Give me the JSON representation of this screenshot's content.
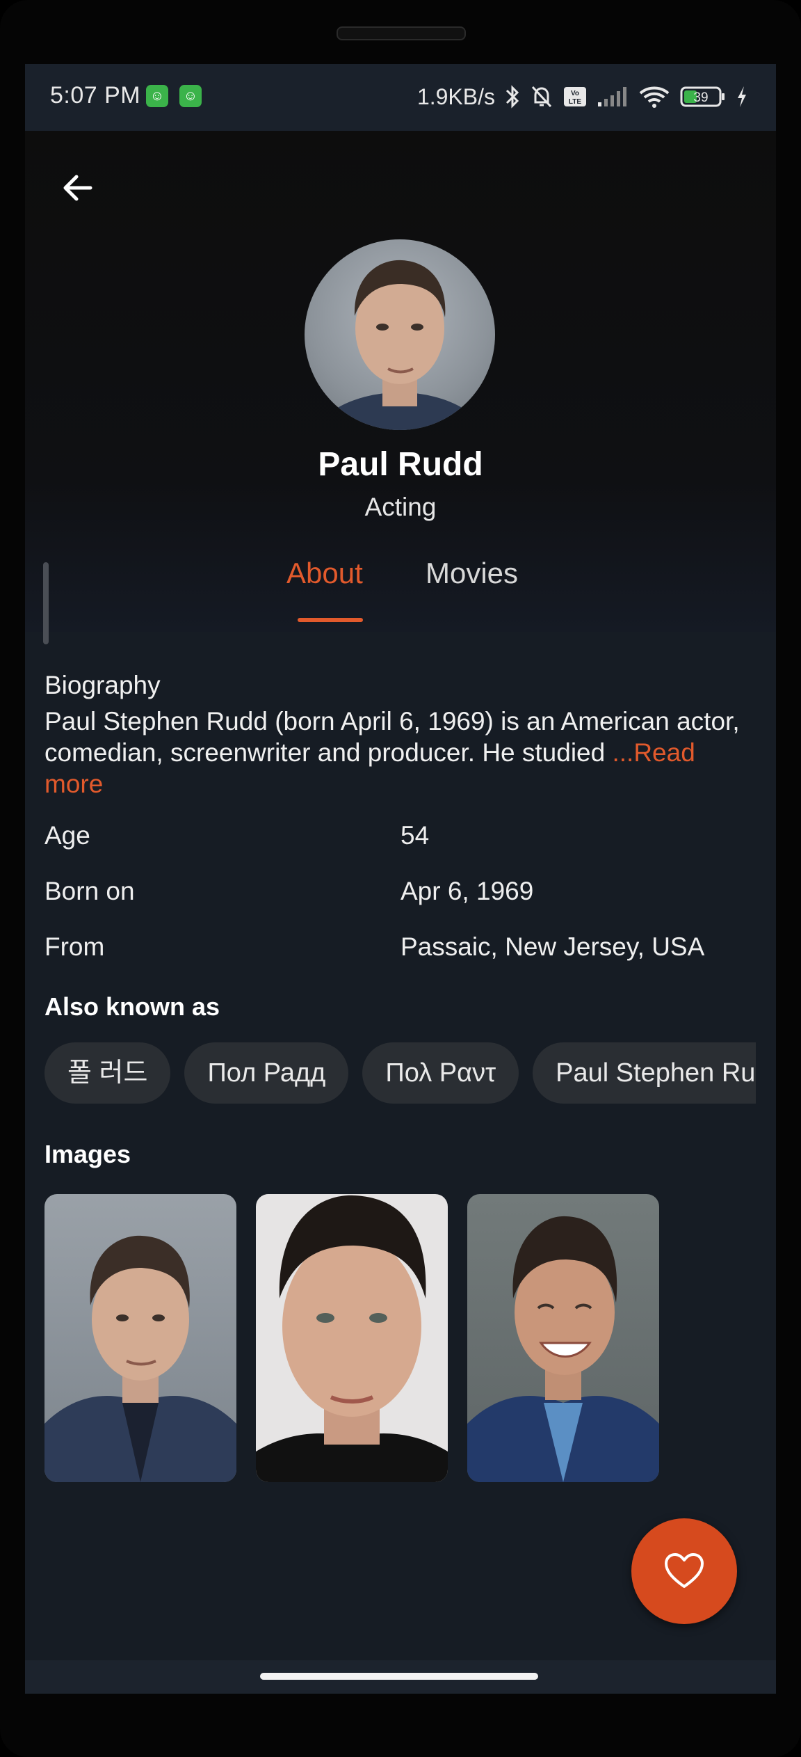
{
  "status_bar": {
    "time": "5:07 PM",
    "net_speed": "1.9KB/s",
    "volte": "Vo LTE",
    "battery": "39"
  },
  "person": {
    "name": "Paul Rudd",
    "department": "Acting"
  },
  "tabs": [
    {
      "label": "About",
      "active": true
    },
    {
      "label": "Movies",
      "active": false
    }
  ],
  "about": {
    "biography_heading": "Biography",
    "biography_text": "Paul Stephen Rudd (born April 6, 1969) is an American actor, comedian, screenwriter and producer. He studied ",
    "read_more": " ...Read more",
    "info": [
      {
        "label": "Age",
        "value": "54"
      },
      {
        "label": "Born on",
        "value": "Apr 6, 1969"
      },
      {
        "label": "From",
        "value": "Passaic, New Jersey, USA"
      }
    ],
    "aka_heading": "Also known as",
    "aka": [
      "폴 러드",
      "Пол Радд",
      "Πολ Ραντ",
      "Paul Stephen Rudd"
    ],
    "images_heading": "Images"
  },
  "colors": {
    "accent": "#e25a2c",
    "fab": "#d64a1e",
    "background": "#161c24",
    "chip": "#2a2e33"
  },
  "icons": {
    "back": "arrow-left-icon",
    "favorite": "heart-outline-icon"
  }
}
